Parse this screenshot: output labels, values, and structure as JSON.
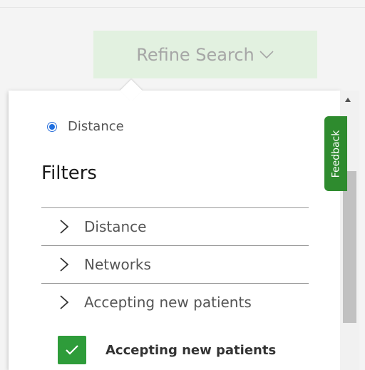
{
  "header": {
    "refine_label": "Refine Search"
  },
  "panel": {
    "radio_label": "Distance",
    "filters_title": "Filters",
    "accordion": [
      {
        "label": "Distance"
      },
      {
        "label": "Networks"
      },
      {
        "label": "Accepting new patients"
      }
    ],
    "checkbox": {
      "label": "Accepting new patients",
      "checked": true
    }
  },
  "feedback": {
    "label": "Feedback"
  },
  "colors": {
    "accent_green": "#2e9c3a",
    "refine_bg": "#e2f1e0",
    "radio_blue": "#1f6fe0"
  }
}
